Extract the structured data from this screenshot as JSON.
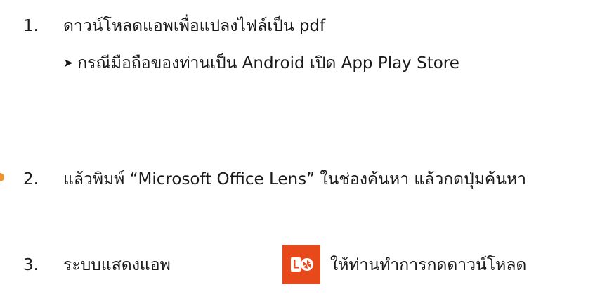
{
  "steps": [
    {
      "number": "1.",
      "text": "ดาวน์โหลดแอพเพื่อแปลงไฟล์เป็น pdf",
      "sub": "กรณีมือถือของท่านเป็น Android เปิด App Play Store",
      "sub_bullet_icon": "arrowhead-bullet-icon"
    },
    {
      "number": "2.",
      "text": "แล้วพิมพ์ “Microsoft Office Lens” ในช่องค้นหา แล้วกดปุ่มค้นหา",
      "bullet_color": "#f0922d"
    },
    {
      "number": "3.",
      "text_before": "ระบบแสดงแอพ",
      "text_after": "ให้ท่านทำการกดดาวน์โหลด",
      "app_icon": "office-lens-app-icon",
      "app_icon_color": "#e8491b"
    }
  ]
}
